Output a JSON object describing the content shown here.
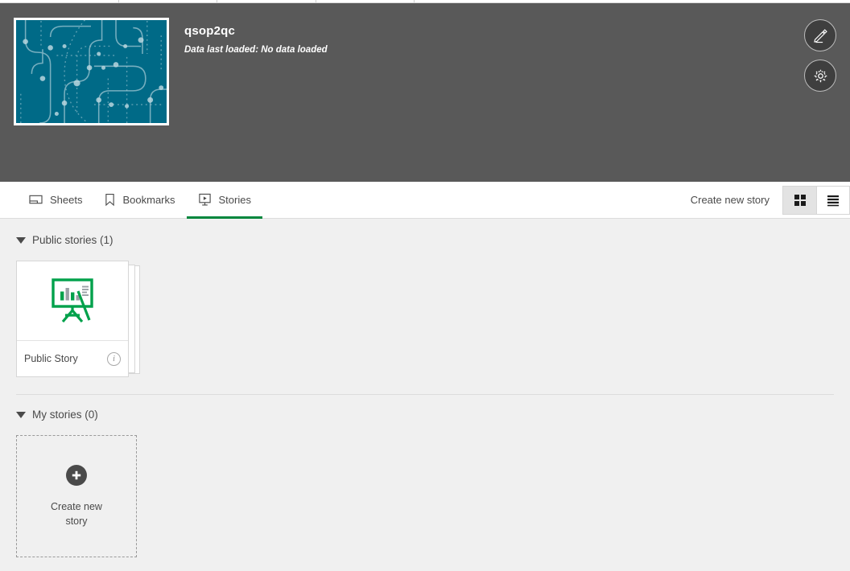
{
  "colors": {
    "header_bg": "#595959",
    "accent_green": "#00873d",
    "story_icon_green": "#00a14b",
    "thumb_teal": "#006a87",
    "content_bg": "#f0f0f0",
    "text_dark": "#4a4a4a"
  },
  "app": {
    "title": "qsop2qc",
    "subtitle": "Data last loaded: No data loaded",
    "thumbnail_name": "app-thumbnail-abstract-teal",
    "edit_button": "edit-app",
    "settings_button": "app-settings"
  },
  "tabs": [
    {
      "label": "Sheets",
      "icon": "sheet-icon",
      "active": false
    },
    {
      "label": "Bookmarks",
      "icon": "bookmark-icon",
      "active": false
    },
    {
      "label": "Stories",
      "icon": "story-icon",
      "active": true
    }
  ],
  "toolbar": {
    "create_link": "Create new story",
    "grid_view_label": "grid-view",
    "list_view_label": "list-view",
    "active_view": "grid"
  },
  "sections": [
    {
      "title": "Public stories (1)",
      "name": "public-stories",
      "expanded": true,
      "stories": [
        {
          "name": "Public Story",
          "info": "i"
        }
      ]
    },
    {
      "title": "My stories (0)",
      "name": "my-stories",
      "expanded": true,
      "stories": [],
      "create_tile_label_line1": "Create new",
      "create_tile_label_line2": "story"
    }
  ]
}
